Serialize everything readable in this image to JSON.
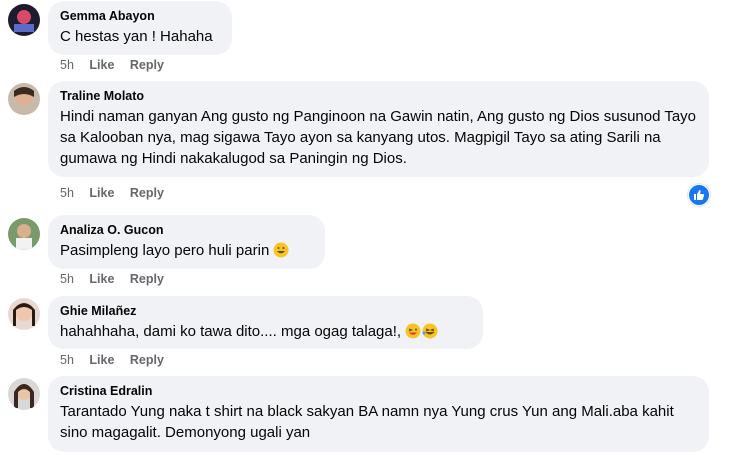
{
  "comments": [
    {
      "author": "Gemma Abayon",
      "text": "C hestas yan ! Hahaha",
      "time": "5h",
      "like": "Like",
      "reply": "Reply"
    },
    {
      "author": "Traline Molato",
      "text": "Hindi naman ganyan Ang gusto ng Panginoon na Gawin natin, Ang gusto ng Dios susunod Tayo sa Kalooban nya, mag sigawa Tayo ayon sa kanyang utos. Magpigil Tayo sa ating Sarili na gumawa ng Hindi nakakalugod sa Paningin ng Dios.",
      "time": "5h",
      "like": "Like",
      "reply": "Reply",
      "reaction": "like-reaction-icon"
    },
    {
      "author": "Analiza O. Gucon",
      "text": "Pasimpleng layo pero huli parin",
      "time": "5h",
      "like": "Like",
      "reply": "Reply",
      "emoji": "grinning-face-icon"
    },
    {
      "author": "Ghie Milañez",
      "text": "hahahhaha, dami ko tawa dito.... mga ogag talaga!,",
      "time": "5h",
      "like": "Like",
      "reply": "Reply",
      "emoji": "laughing-emojis-icon"
    },
    {
      "author": "Cristina Edralin",
      "text": "Tarantado Yung naka t shirt na black sakyan BA namn nya Yung crus Yun ang Mali.aba kahit sino magagalit. Demonyong ugali yan"
    }
  ],
  "colors": {
    "bubble": "#f0f2f5",
    "meta": "#65676b",
    "like_blue": "#1877f2"
  }
}
